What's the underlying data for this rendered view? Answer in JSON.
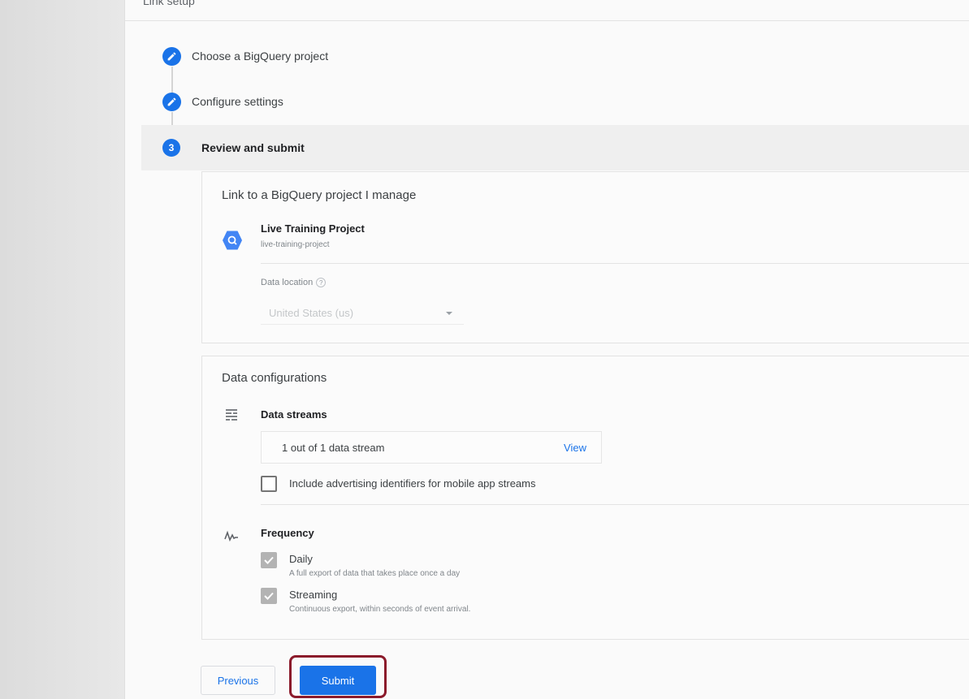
{
  "panel": {
    "header_title": "Link setup"
  },
  "steps": [
    {
      "label": "Choose a BigQuery project",
      "state": "completed",
      "icon": "pencil-icon"
    },
    {
      "label": "Configure settings",
      "state": "completed",
      "icon": "pencil-icon"
    },
    {
      "label": "Review and submit",
      "state": "active",
      "number": "3"
    }
  ],
  "link_card": {
    "title": "Link to a BigQuery project I manage",
    "project_icon": "bigquery-icon",
    "project_name": "Live Training Project",
    "project_id": "live-training-project",
    "data_location_label": "Data location",
    "help_glyph": "?",
    "data_location_value": "United States (us)"
  },
  "config_card": {
    "title": "Data configurations",
    "streams": {
      "icon": "data-streams-icon",
      "label": "Data streams",
      "summary": "1 out of 1 data stream",
      "view_link": "View",
      "advertising_checkbox_label": "Include advertising identifiers for mobile app streams",
      "advertising_checked": false
    },
    "frequency": {
      "icon": "frequency-icon",
      "label": "Frequency",
      "options": [
        {
          "label": "Daily",
          "description": "A full export of data that takes place once a day",
          "checked": true
        },
        {
          "label": "Streaming",
          "description": "Continuous export, within seconds of event arrival.",
          "checked": true
        }
      ]
    }
  },
  "footer": {
    "previous_label": "Previous",
    "submit_label": "Submit"
  },
  "colors": {
    "accent": "#1a73e8",
    "highlight_ring": "#8b1a2b"
  }
}
